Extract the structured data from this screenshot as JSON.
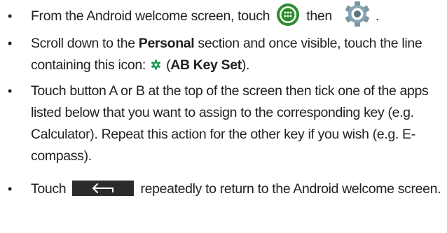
{
  "steps": [
    {
      "prefix": "From the Android welcome screen, touch",
      "middle": "then",
      "suffix": ".",
      "icons": [
        "apps-icon",
        "settings-gear-icon"
      ]
    },
    {
      "prefix": "Scroll down to the ",
      "bold1": "Personal",
      "middle": " section and once visible, touch the line containing this icon: ",
      "open_paren": " (",
      "bold2": "AB Key Set",
      "close_paren": ")."
    },
    {
      "text": "Touch button A or B at the top of the screen then tick one of the apps listed below that you want to assign to the corresponding key (e.g. Calculator). Repeat this action for the other key if you wish (e.g. E-compass)."
    },
    {
      "prefix": "Touch",
      "suffix": "repeatedly to return to the Android welcome screen.",
      "icons": [
        "back-key-icon"
      ]
    }
  ],
  "bullet_char": "•",
  "colors": {
    "text": "#231f20",
    "apps_icon_green": "#2e8b2e",
    "gear_green": "#1f9c54",
    "settings_blue_grey": "#7a95a6",
    "back_key_bg": "#2b2b2b"
  }
}
